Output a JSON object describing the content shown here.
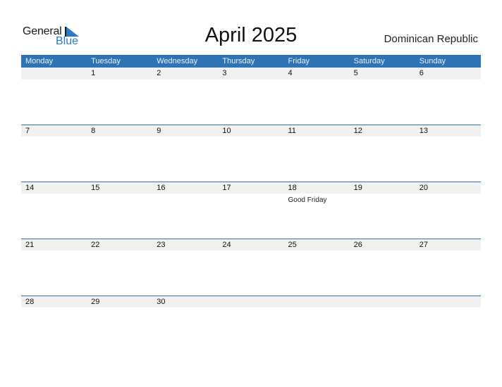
{
  "logo": {
    "word1": "General",
    "word2": "Blue",
    "icon": "triangle-flag-icon",
    "accent": "#2a7bc4"
  },
  "title": "April 2025",
  "country": "Dominican Republic",
  "colors": {
    "header_bg": "#2e73b4",
    "row_bg": "#f1f1f1"
  },
  "weekdays": [
    "Monday",
    "Tuesday",
    "Wednesday",
    "Thursday",
    "Friday",
    "Saturday",
    "Sunday"
  ],
  "weeks": [
    [
      {
        "day": ""
      },
      {
        "day": "1"
      },
      {
        "day": "2"
      },
      {
        "day": "3"
      },
      {
        "day": "4"
      },
      {
        "day": "5"
      },
      {
        "day": "6"
      }
    ],
    [
      {
        "day": "7"
      },
      {
        "day": "8"
      },
      {
        "day": "9"
      },
      {
        "day": "10"
      },
      {
        "day": "11"
      },
      {
        "day": "12"
      },
      {
        "day": "13"
      }
    ],
    [
      {
        "day": "14"
      },
      {
        "day": "15"
      },
      {
        "day": "16"
      },
      {
        "day": "17"
      },
      {
        "day": "18",
        "holiday": "Good Friday"
      },
      {
        "day": "19"
      },
      {
        "day": "20"
      }
    ],
    [
      {
        "day": "21"
      },
      {
        "day": "22"
      },
      {
        "day": "23"
      },
      {
        "day": "24"
      },
      {
        "day": "25"
      },
      {
        "day": "26"
      },
      {
        "day": "27"
      }
    ],
    [
      {
        "day": "28"
      },
      {
        "day": "29"
      },
      {
        "day": "30"
      },
      {
        "day": ""
      },
      {
        "day": ""
      },
      {
        "day": ""
      },
      {
        "day": ""
      }
    ]
  ]
}
